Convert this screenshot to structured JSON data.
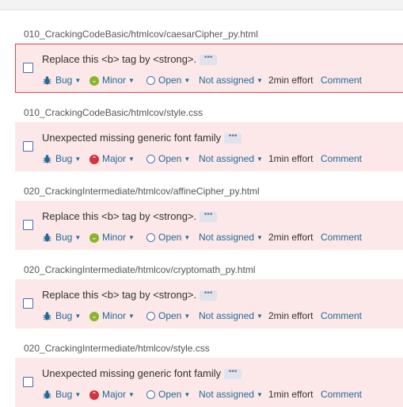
{
  "colors": {
    "issue_bg": "#fce8e8",
    "selected_border": "#d44a4a",
    "link": "#236a97",
    "minor": "#8ab52a",
    "major": "#d4333f",
    "open_ring": "#4b6eaf"
  },
  "issues": [
    {
      "file": "010_CrackingCodeBasic/htmlcov/caesarCipher_py.html",
      "message": "Replace this <b> tag by <strong>.",
      "type": "Bug",
      "severity": "Minor",
      "severity_icon": "minor-icon",
      "status": "Open",
      "assignee": "Not assigned",
      "effort": "2min effort",
      "comment": "Comment",
      "selected": true
    },
    {
      "file": "010_CrackingCodeBasic/htmlcov/style.css",
      "message": "Unexpected missing generic font family",
      "type": "Bug",
      "severity": "Major",
      "severity_icon": "major-icon",
      "status": "Open",
      "assignee": "Not assigned",
      "effort": "1min effort",
      "comment": "Comment",
      "selected": false
    },
    {
      "file": "020_CrackingIntermediate/htmlcov/affineCipher_py.html",
      "message": "Replace this <b> tag by <strong>.",
      "type": "Bug",
      "severity": "Minor",
      "severity_icon": "minor-icon",
      "status": "Open",
      "assignee": "Not assigned",
      "effort": "2min effort",
      "comment": "Comment",
      "selected": false
    },
    {
      "file": "020_CrackingIntermediate/htmlcov/cryptomath_py.html",
      "message": "Replace this <b> tag by <strong>.",
      "type": "Bug",
      "severity": "Minor",
      "severity_icon": "minor-icon",
      "status": "Open",
      "assignee": "Not assigned",
      "effort": "2min effort",
      "comment": "Comment",
      "selected": false
    },
    {
      "file": "020_CrackingIntermediate/htmlcov/style.css",
      "message": "Unexpected missing generic font family",
      "type": "Bug",
      "severity": "Major",
      "severity_icon": "major-icon",
      "status": "Open",
      "assignee": "Not assigned",
      "effort": "1min effort",
      "comment": "Comment",
      "selected": false
    }
  ]
}
